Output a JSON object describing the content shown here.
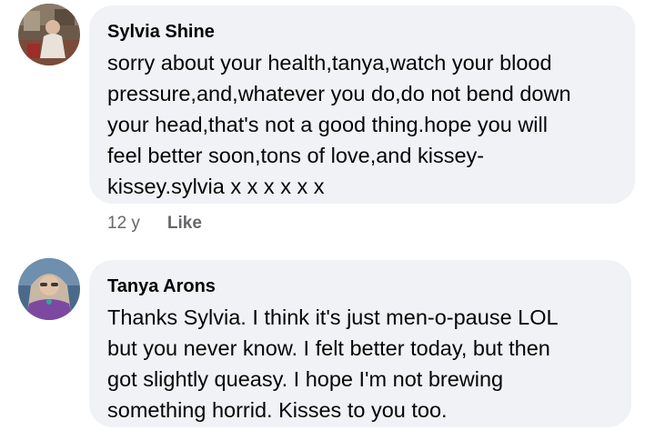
{
  "comments": [
    {
      "author": "Sylvia Shine",
      "text": "sorry about your health,tanya,watch your blood\npressure,and,whatever you do,do not bend down\nyour head,that's not a good thing.hope you will\nfeel better soon,tons of love,and kissey-\nkissey.sylvia x x x x x x",
      "time": "12 y",
      "like_label": "Like"
    },
    {
      "author": "Tanya Arons",
      "text": "Thanks Sylvia.  I think it's just men-o-pause LOL\nbut you never know.  I felt better today, but then\ngot slightly queasy.  I hope I'm not brewing\nsomething horrid.   Kisses to you too."
    }
  ]
}
